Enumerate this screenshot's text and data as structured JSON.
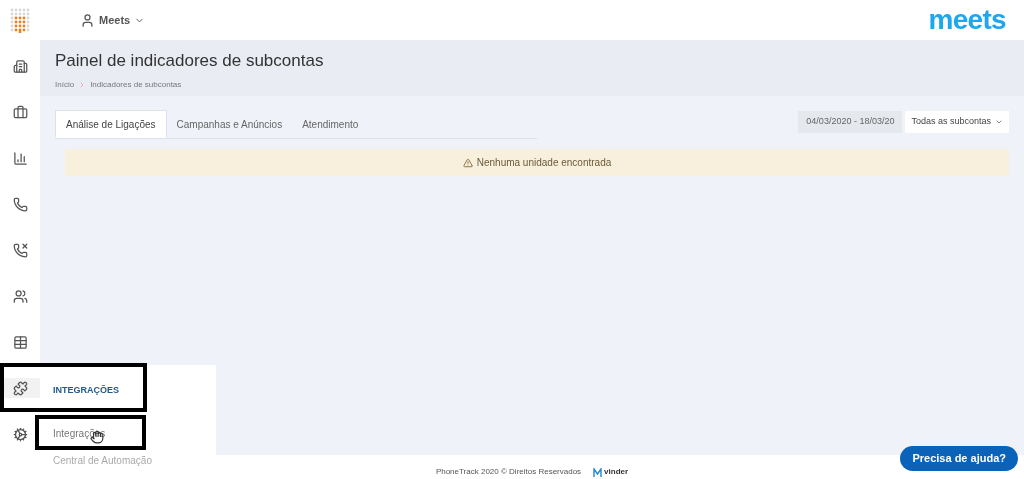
{
  "topbar": {
    "account": "Meets",
    "logo": "meets"
  },
  "sidebar": {
    "items": [
      {
        "kind": "building",
        "selected": false
      },
      {
        "kind": "briefcase",
        "selected": false
      },
      {
        "kind": "signal",
        "selected": false
      },
      {
        "kind": "phone",
        "selected": false
      },
      {
        "kind": "phone-x",
        "selected": false
      },
      {
        "kind": "users",
        "selected": false
      },
      {
        "kind": "table",
        "selected": false
      },
      {
        "kind": "puzzle",
        "selected": true
      },
      {
        "kind": "gears",
        "selected": false
      }
    ]
  },
  "flyout": {
    "heading": "INTEGRAÇÕES",
    "items": [
      {
        "label": "Integrações",
        "selected": true
      },
      {
        "label": "Central de Automação",
        "selected": false
      }
    ]
  },
  "header": {
    "title": "Painel de indicadores de subcontas",
    "breadcrumb": [
      "Início",
      "Indicadores de subcontas"
    ]
  },
  "tabs": [
    {
      "label": "Análise de Ligações",
      "selected": true
    },
    {
      "label": "Campanhas e Anúncios",
      "selected": false
    },
    {
      "label": "Atendimento",
      "selected": false
    }
  ],
  "date_range": "04/03/2020 - 18/03/20",
  "subaccount_select": "Todas as subcontas",
  "alert": "Nenhuma unidade encontrada",
  "footer": {
    "text": "PhoneTrack 2020 © Direitos Reservados",
    "brand": "vinder"
  },
  "help_button": "Precisa de ajuda?"
}
